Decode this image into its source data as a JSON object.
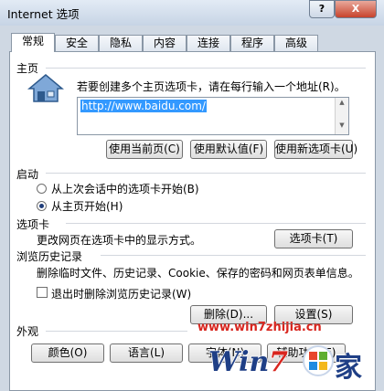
{
  "window": {
    "title": "Internet 选项",
    "help_label": "?",
    "close_label": "X"
  },
  "tabs": [
    {
      "label": "常规",
      "active": true
    },
    {
      "label": "安全"
    },
    {
      "label": "隐私"
    },
    {
      "label": "内容"
    },
    {
      "label": "连接"
    },
    {
      "label": "程序"
    },
    {
      "label": "高级"
    }
  ],
  "home": {
    "heading": "主页",
    "description": "若要创建多个主页选项卡，请在每行输入一个地址(R)。",
    "url": "http://www.baidu.com/",
    "use_current": "使用当前页(C)",
    "use_default": "使用默认值(F)",
    "use_new_tab": "使用新选项卡(U)"
  },
  "startup": {
    "heading": "启动",
    "option_last_session": "从上次会话中的选项卡开始(B)",
    "option_home": "从主页开始(H)"
  },
  "tabs_section": {
    "heading": "选项卡",
    "description": "更改网页在选项卡中的显示方式。",
    "button": "选项卡(T)"
  },
  "history": {
    "heading": "浏览历史记录",
    "description": "删除临时文件、历史记录、Cookie、保存的密码和网页表单信息。",
    "checkbox_label": "退出时删除浏览历史记录(W)",
    "delete_button": "删除(D)...",
    "settings_button": "设置(S)"
  },
  "appearance": {
    "heading": "外观",
    "colors_button": "颜色(O)",
    "languages_button": "语言(L)",
    "fonts_button": "字体(N)",
    "accessibility_button": "辅助功能(E)"
  },
  "watermark": {
    "url": "www.win7zhijia.cn",
    "brand": "Win7之家"
  },
  "colors": {
    "selection": "#3399ff",
    "watermark_red": "#d8261f"
  }
}
